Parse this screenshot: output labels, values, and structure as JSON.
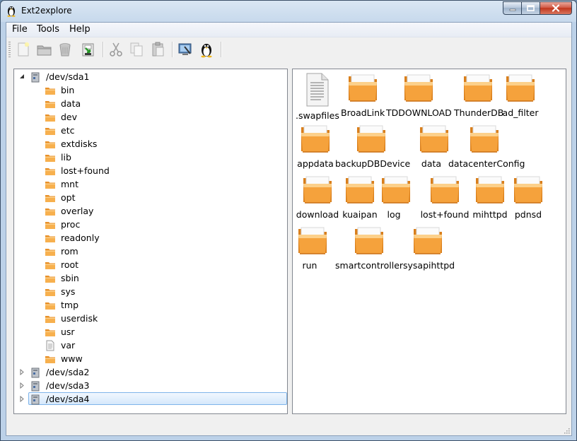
{
  "window": {
    "title": "Ext2explore",
    "controls": {
      "minimize": "‒",
      "maximize": "□",
      "close": "✕"
    }
  },
  "menubar": {
    "items": [
      {
        "label": "File"
      },
      {
        "label": "Tools"
      },
      {
        "label": "Help"
      }
    ]
  },
  "toolbar": {
    "buttons": [
      {
        "icon": "new-file-icon"
      },
      {
        "icon": "open-folder-icon"
      },
      {
        "icon": "trash-icon"
      },
      {
        "icon": "save-export-icon"
      },
      {
        "icon": "cut-icon"
      },
      {
        "icon": "copy-icon"
      },
      {
        "icon": "paste-icon"
      },
      {
        "icon": "properties-icon"
      },
      {
        "icon": "linux-tux-icon"
      }
    ]
  },
  "tree": {
    "drives": [
      {
        "label": "/dev/sda1",
        "expanded": true,
        "children": [
          {
            "label": "bin",
            "type": "folder"
          },
          {
            "label": "data",
            "type": "folder"
          },
          {
            "label": "dev",
            "type": "folder"
          },
          {
            "label": "etc",
            "type": "folder"
          },
          {
            "label": "extdisks",
            "type": "folder"
          },
          {
            "label": "lib",
            "type": "folder"
          },
          {
            "label": "lost+found",
            "type": "folder"
          },
          {
            "label": "mnt",
            "type": "folder"
          },
          {
            "label": "opt",
            "type": "folder"
          },
          {
            "label": "overlay",
            "type": "folder"
          },
          {
            "label": "proc",
            "type": "folder"
          },
          {
            "label": "readonly",
            "type": "folder"
          },
          {
            "label": "rom",
            "type": "folder"
          },
          {
            "label": "root",
            "type": "folder"
          },
          {
            "label": "sbin",
            "type": "folder"
          },
          {
            "label": "sys",
            "type": "folder"
          },
          {
            "label": "tmp",
            "type": "folder"
          },
          {
            "label": "userdisk",
            "type": "folder"
          },
          {
            "label": "usr",
            "type": "folder"
          },
          {
            "label": "var",
            "type": "file"
          },
          {
            "label": "www",
            "type": "folder"
          }
        ]
      },
      {
        "label": "/dev/sda2",
        "expanded": false
      },
      {
        "label": "/dev/sda3",
        "expanded": false
      },
      {
        "label": "/dev/sda4",
        "expanded": false,
        "selected": true
      }
    ]
  },
  "files": {
    "items": [
      {
        "label": ".swapfiles",
        "type": "file"
      },
      {
        "label": "BroadLink",
        "type": "folder"
      },
      {
        "label": "TDDOWNLOAD",
        "type": "folder"
      },
      {
        "label": "ThunderDB",
        "type": "folder"
      },
      {
        "label": "ad_filter",
        "type": "folder"
      },
      {
        "label": "appdata",
        "type": "folder"
      },
      {
        "label": "backupDBDevice",
        "type": "folder"
      },
      {
        "label": "data",
        "type": "folder"
      },
      {
        "label": "datacenterConfig",
        "type": "folder"
      },
      {
        "label": "download",
        "type": "folder"
      },
      {
        "label": "kuaipan",
        "type": "folder"
      },
      {
        "label": "log",
        "type": "folder"
      },
      {
        "label": "lost+found",
        "type": "folder"
      },
      {
        "label": "mihttpd",
        "type": "folder"
      },
      {
        "label": "pdnsd",
        "type": "folder"
      },
      {
        "label": "run",
        "type": "folder"
      },
      {
        "label": "smartcontroller",
        "type": "folder"
      },
      {
        "label": "sysapihttpd",
        "type": "folder"
      }
    ]
  },
  "colors": {
    "folder_main": "#f4a43a",
    "folder_light": "#fbd28d",
    "selection_border": "#7eb4ea",
    "titlebar": "#c7d9ec"
  }
}
